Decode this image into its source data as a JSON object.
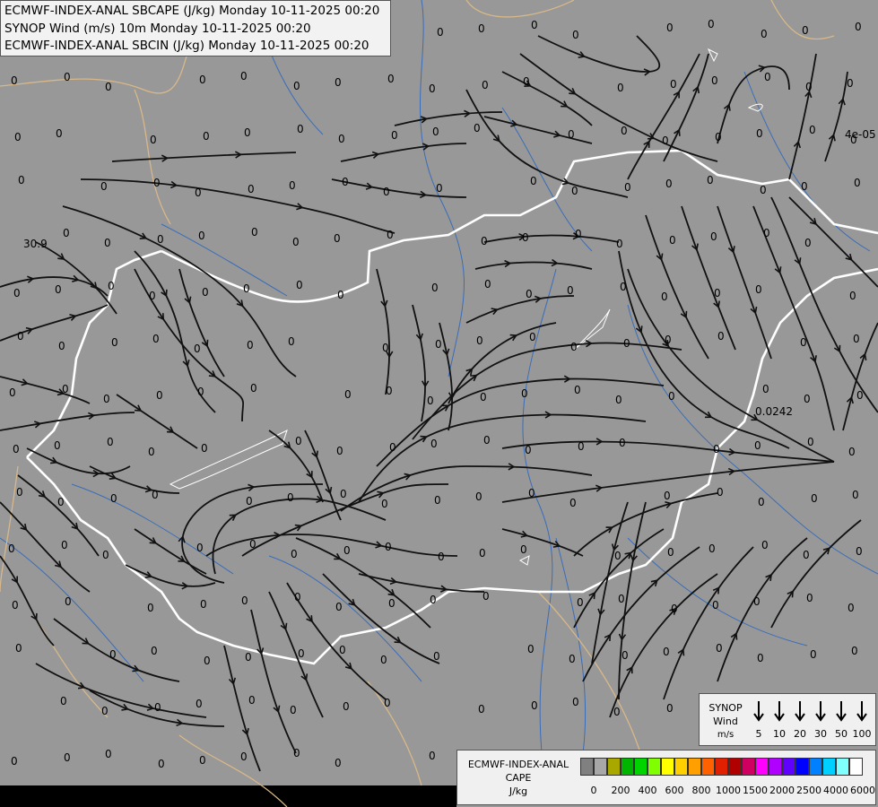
{
  "title_lines": [
    "ECMWF-INDEX-ANAL SBCAPE (J/kg) Monday 10-11-2025 00:20",
    "SYNOP Wind (m/s) 10m Monday 10-11-2025 00:20",
    "ECMWF-INDEX-ANAL SBCIN (J/kg) Monday 10-11-2025 00:20"
  ],
  "station_values": {
    "zero": "0",
    "w1": "30.9",
    "e1": "4e-05",
    "e2": "0.0242"
  },
  "wind_legend": {
    "label_lines": [
      "SYNOP",
      "Wind",
      "m/s"
    ],
    "speeds": [
      "5",
      "10",
      "20",
      "30",
      "50",
      "100"
    ]
  },
  "cape_legend": {
    "label_lines": [
      "ECMWF-INDEX-ANAL",
      "CAPE",
      "J/kg"
    ],
    "tick_labels": [
      "0",
      "200",
      "400",
      "600",
      "800",
      "1000",
      "1500",
      "2000",
      "2500",
      "4000",
      "6000"
    ],
    "colors": [
      "#808080",
      "#a8a8a8",
      "#a8a800",
      "#00b400",
      "#00d400",
      "#80ff00",
      "#ffff00",
      "#ffd000",
      "#ffa000",
      "#ff6000",
      "#e02000",
      "#b00000",
      "#d00060",
      "#ff00ff",
      "#b000ff",
      "#6000ff",
      "#0000ff",
      "#0080ff",
      "#00d0ff",
      "#80ffff",
      "#ffffff"
    ]
  },
  "map_colors": {
    "background": "#989898",
    "streamline": "#111111",
    "border": "#ffffff",
    "rivers": "#3a6db8",
    "outer_borders": "#d8b888"
  }
}
